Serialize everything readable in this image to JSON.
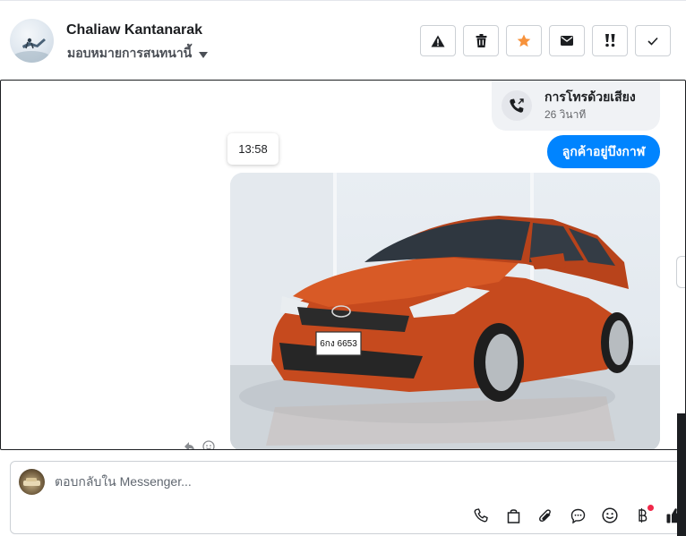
{
  "header": {
    "contact_name": "Chaliaw Kantanarak",
    "assign_label": "มอบหมายการสนทนานี้",
    "actions": [
      {
        "name": "mark-spam",
        "icon": "warning-icon"
      },
      {
        "name": "delete",
        "icon": "trash-icon"
      },
      {
        "name": "star",
        "icon": "star-icon",
        "color": "#f7923b"
      },
      {
        "name": "mark-unread",
        "icon": "envelope-icon"
      },
      {
        "name": "follow-up",
        "icon": "exclamation-icon"
      },
      {
        "name": "mark-done",
        "icon": "check-icon"
      }
    ]
  },
  "thread": {
    "call": {
      "title": "การโทรด้วยเสียง",
      "duration": "26 วินาที"
    },
    "time_chip": "13:58",
    "message": "ลูกค้าอยู่บึงกาฬ",
    "image": {
      "subject": "red hatchback car",
      "plate": "6กง 6653"
    }
  },
  "composer": {
    "placeholder": "ตอบกลับใน Messenger...",
    "tools": [
      "phone-icon",
      "bag-icon",
      "paperclip-icon",
      "chat-bubble-icon",
      "smiley-icon",
      "baht-icon",
      "thumbs-up-icon"
    ]
  },
  "colors": {
    "accent": "#0084ff",
    "star": "#f7923b",
    "badge": "#f02849"
  }
}
